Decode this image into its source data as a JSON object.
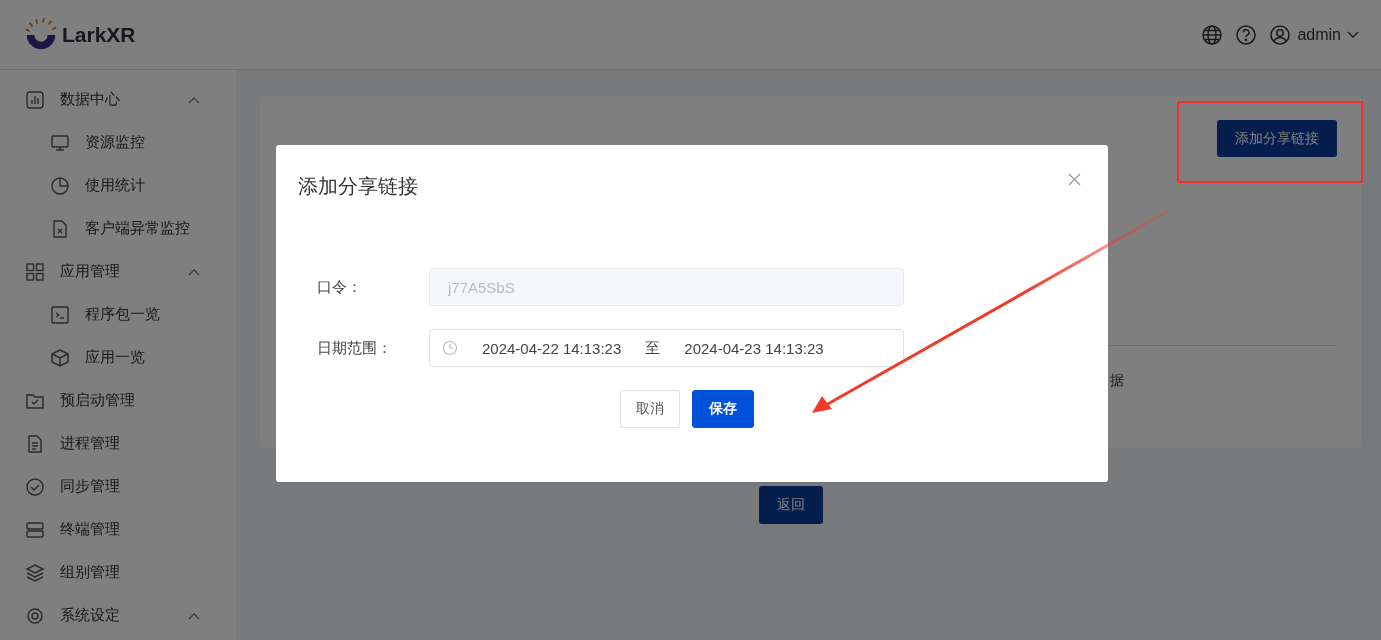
{
  "header": {
    "logo": "LarkXR",
    "user": "admin"
  },
  "sidebar": {
    "items": [
      {
        "label": "数据中心",
        "expanded": true,
        "children": [
          {
            "label": "资源监控"
          },
          {
            "label": "使用统计"
          },
          {
            "label": "客户端异常监控"
          }
        ]
      },
      {
        "label": "应用管理",
        "expanded": true,
        "children": [
          {
            "label": "程序包一览"
          },
          {
            "label": "应用一览"
          }
        ]
      },
      {
        "label": "预启动管理"
      },
      {
        "label": "进程管理"
      },
      {
        "label": "同步管理"
      },
      {
        "label": "终端管理"
      },
      {
        "label": "组别管理"
      },
      {
        "label": "系统设定",
        "expanded": true
      }
    ]
  },
  "card": {
    "add_button": "添加分享链接",
    "fragment": "据",
    "back_button": "返回"
  },
  "dialog": {
    "title": "添加分享链接",
    "fields": [
      {
        "kind": "text",
        "label": "口令：",
        "value": "j77A5SbS",
        "disabled": true
      },
      {
        "kind": "daterange",
        "label": "日期范围：",
        "start": "2024-04-22 14:13:23",
        "separator": "至",
        "end": "2024-04-23 14:13:23"
      }
    ],
    "buttons": [
      {
        "label": "取消",
        "primary": false
      },
      {
        "label": "保存",
        "primary": true
      }
    ]
  }
}
